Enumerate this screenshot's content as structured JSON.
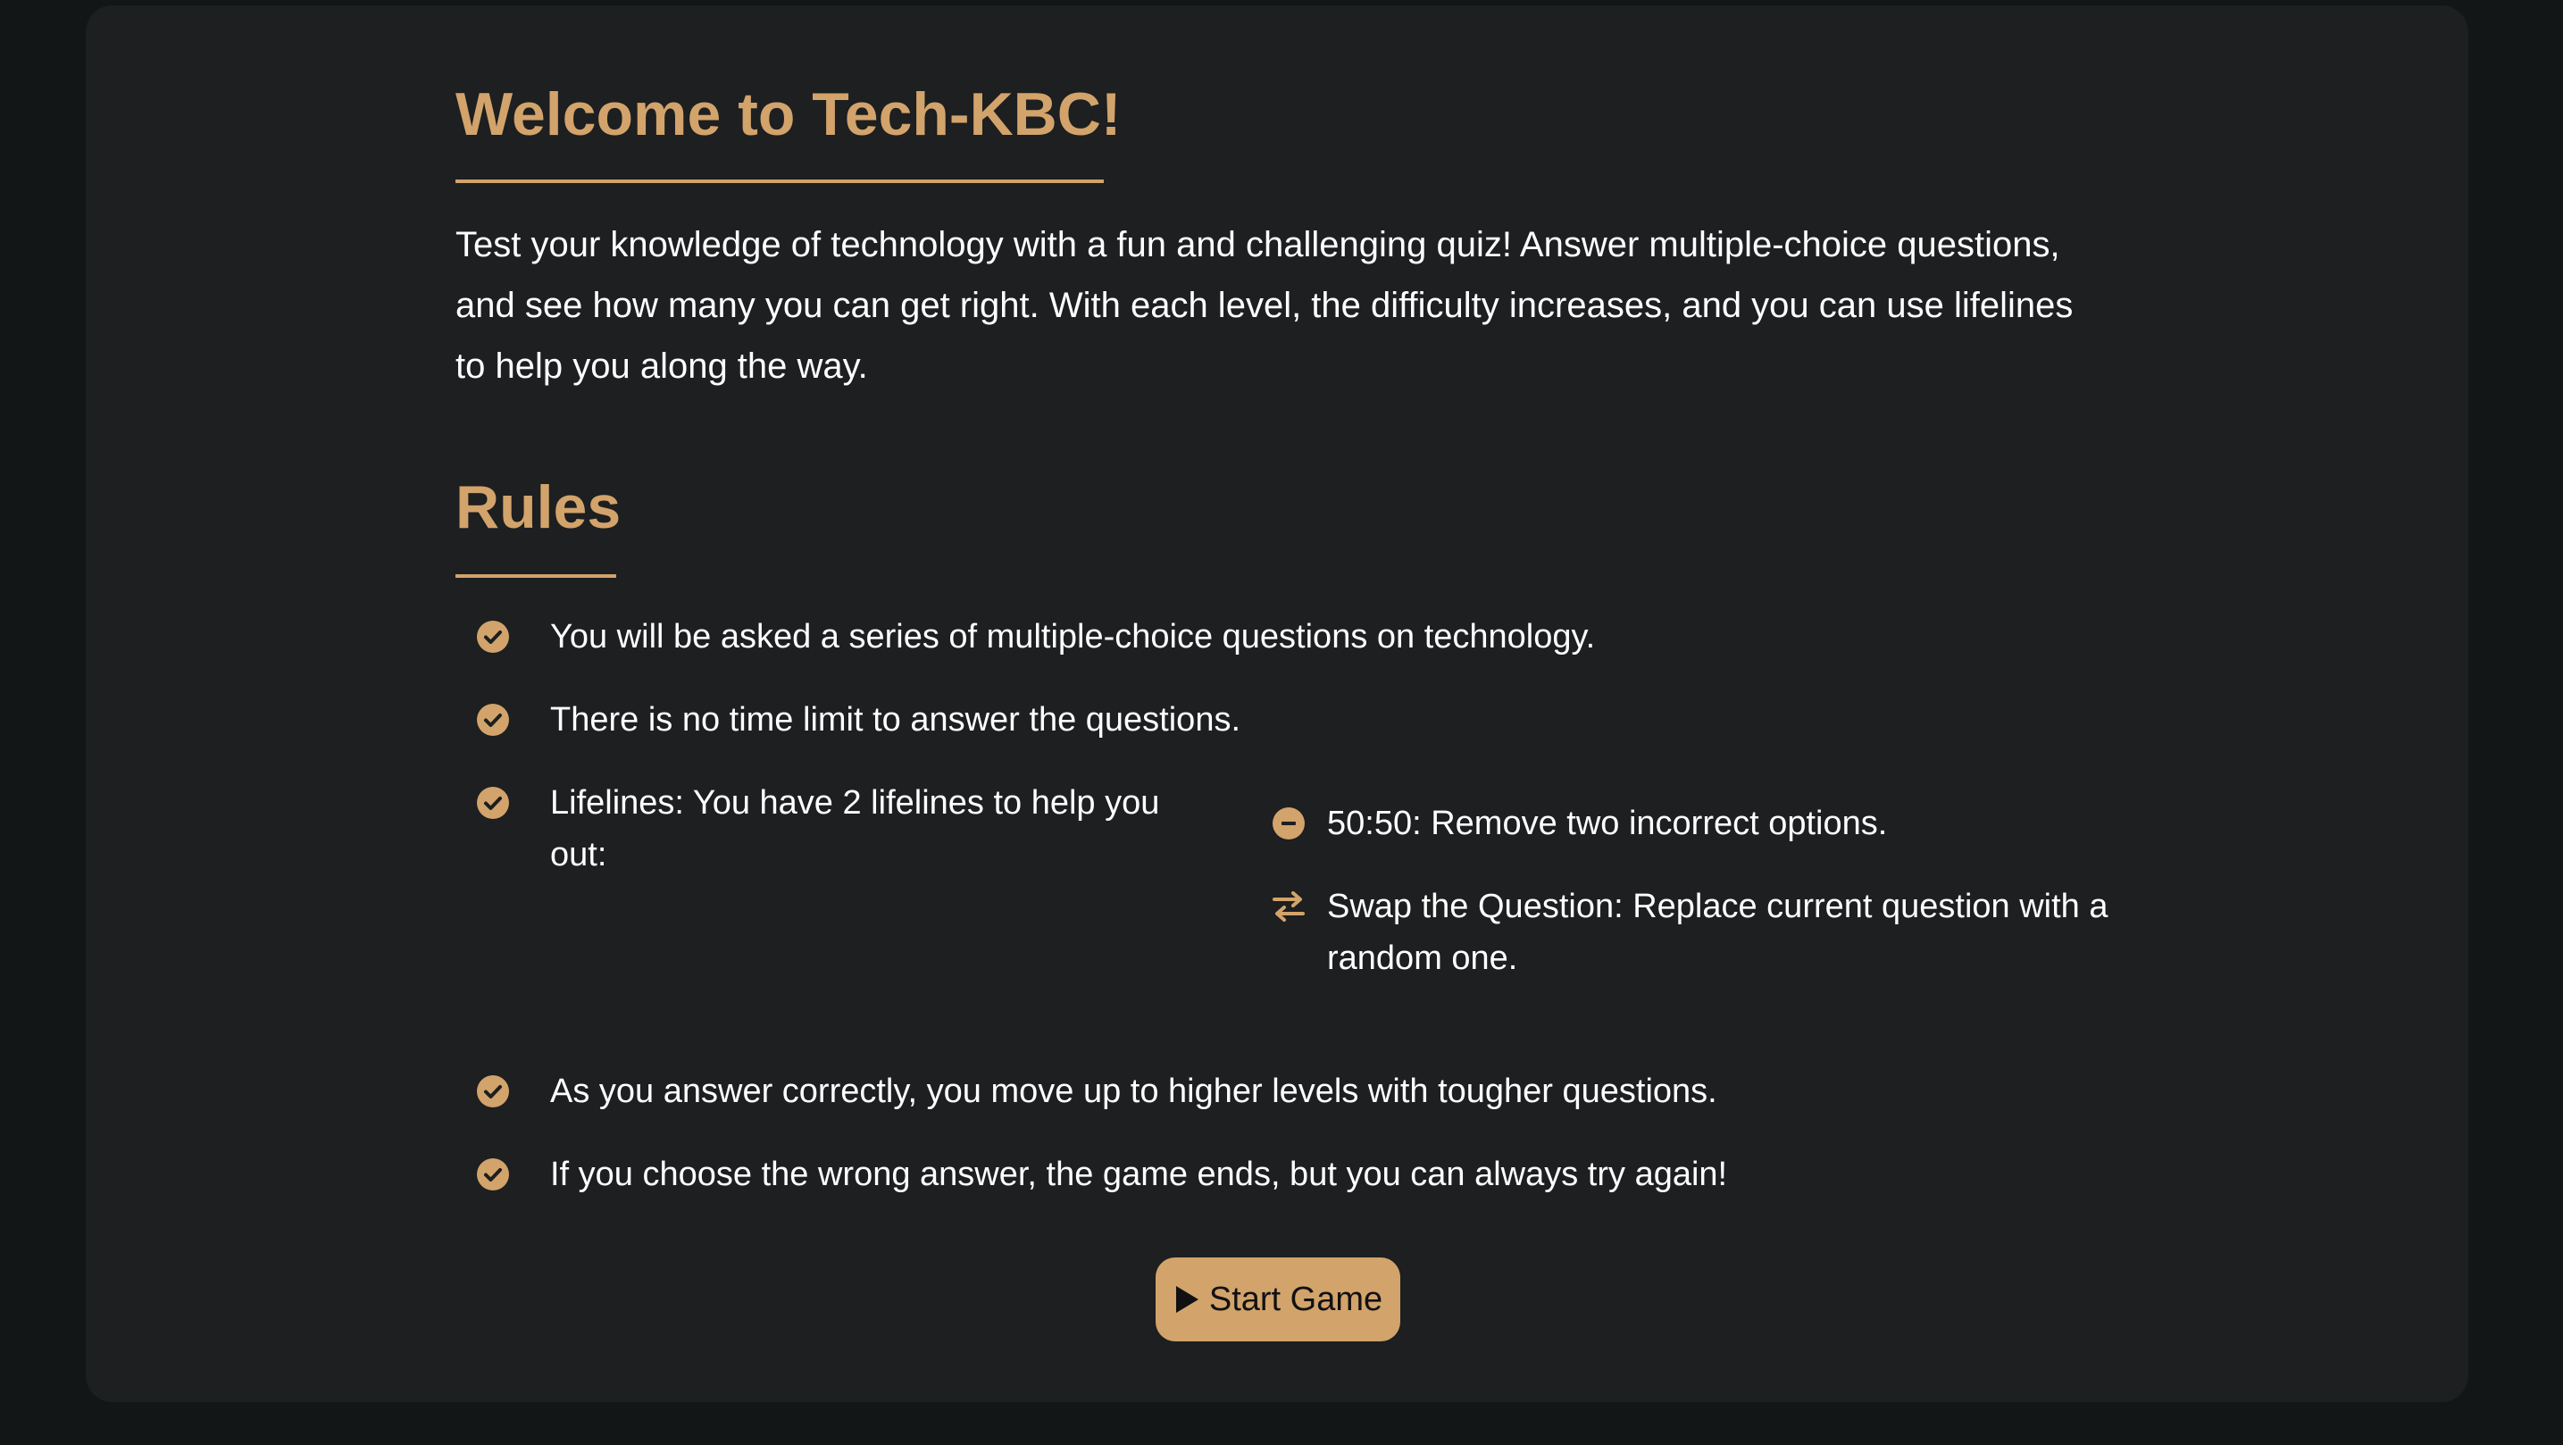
{
  "welcome": {
    "title": "Welcome to Tech-KBC!",
    "intro": "Test your knowledge of technology with a fun and challenging quiz! Answer multiple-choice questions, and see how many you can get right. With each level, the difficulty increases, and you can use lifelines to help you along the way."
  },
  "rules": {
    "title": "Rules",
    "items": [
      {
        "icon": "check-circle-icon",
        "text": "You will be asked a series of multiple-choice questions on technology."
      },
      {
        "icon": "check-circle-icon",
        "text": "There is no time limit to answer the questions."
      },
      {
        "icon": "check-circle-icon",
        "text": "Lifelines: You have 2 lifelines to help you out:"
      },
      {
        "icon": "check-circle-icon",
        "text": "As you answer correctly, you move up to higher levels with tougher questions."
      },
      {
        "icon": "check-circle-icon",
        "text": "If you choose the wrong answer, the game ends, but you can always try again!"
      }
    ],
    "lifelines": [
      {
        "icon": "minus-circle-icon",
        "text": "50:50: Remove two incorrect options."
      },
      {
        "icon": "swap-arrows-icon",
        "text": "Swap the Question: Replace current question with a random one."
      }
    ]
  },
  "start_button": {
    "icon": "play-icon",
    "label": "Start Game"
  },
  "colors": {
    "page_background": "#121617",
    "card_background": "#1d1f20",
    "accent": "#d2a36b",
    "text": "#ffffff",
    "button_text": "#111111"
  }
}
